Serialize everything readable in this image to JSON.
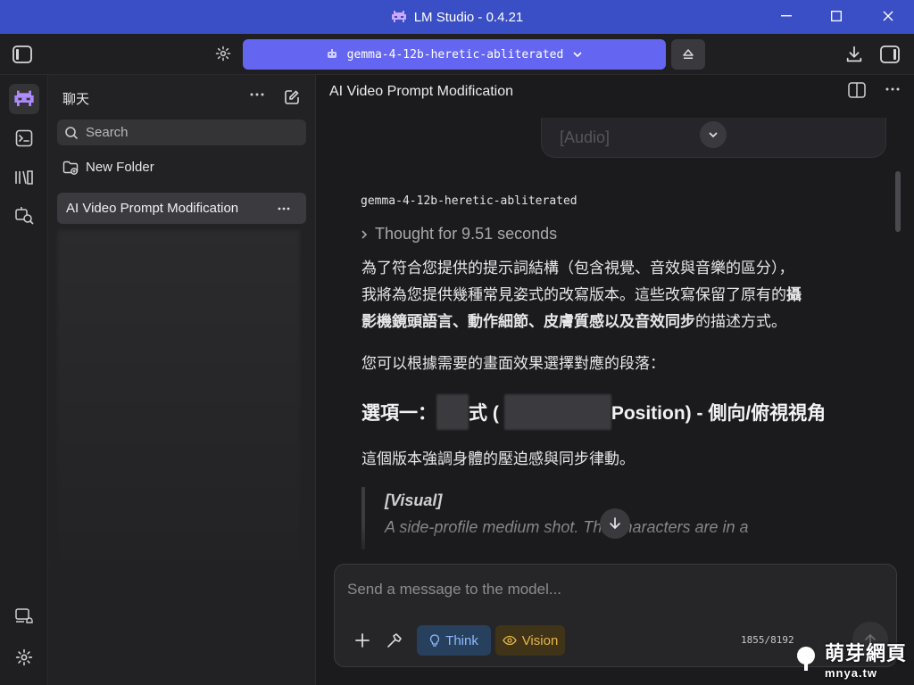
{
  "window": {
    "title": "LM Studio - 0.4.21"
  },
  "toolbar": {
    "model_name": "gemma-4-12b-heretic-abliterated"
  },
  "sidebar": {
    "title": "聊天",
    "search_placeholder": "Search",
    "new_folder_label": "New Folder",
    "active_chat": "AI Video Prompt Modification"
  },
  "main": {
    "chat_title": "AI Video Prompt Modification",
    "prev_message_tail": "[Audio]",
    "model_label": "gemma-4-12b-heretic-abliterated",
    "thought_label": "Thought for 9.51 seconds",
    "para1_line1": "為了符合您提供的提示詞結構（包含視覺、音效與音樂的區分），",
    "para1_line2a": "我將為您提供幾種常見姿式的改寫版本。這些改寫保留了原有的",
    "para1_line2b_bold": "攝",
    "para1_line3a_bold": "影機鏡頭語言、動作細節、皮膚質感以及音效同步",
    "para1_line3b": "的描述方式。",
    "para2": "您可以根據需要的畫面效果選擇對應的段落：",
    "heading_prefix": "選項一：",
    "heading_mid": "式 (",
    "heading_suffix": "Position) - 側向/俯視視角",
    "para3": "這個版本強調身體的壓迫感與同步律動。",
    "quote_title": "[Visual]",
    "quote_line": "A side-profile medium shot. The characters are in a"
  },
  "composer": {
    "placeholder": "Send a message to the model...",
    "think_label": "Think",
    "vision_label": "Vision",
    "token_count": "1855/8192"
  },
  "watermark": {
    "text_cn": "萌芽網頁",
    "text_url": "mnya.tw"
  },
  "colors": {
    "accent": "#6466f1",
    "titlebar": "#3a4fc6",
    "think": "#8fb8ff",
    "vision": "#e7b64a"
  }
}
